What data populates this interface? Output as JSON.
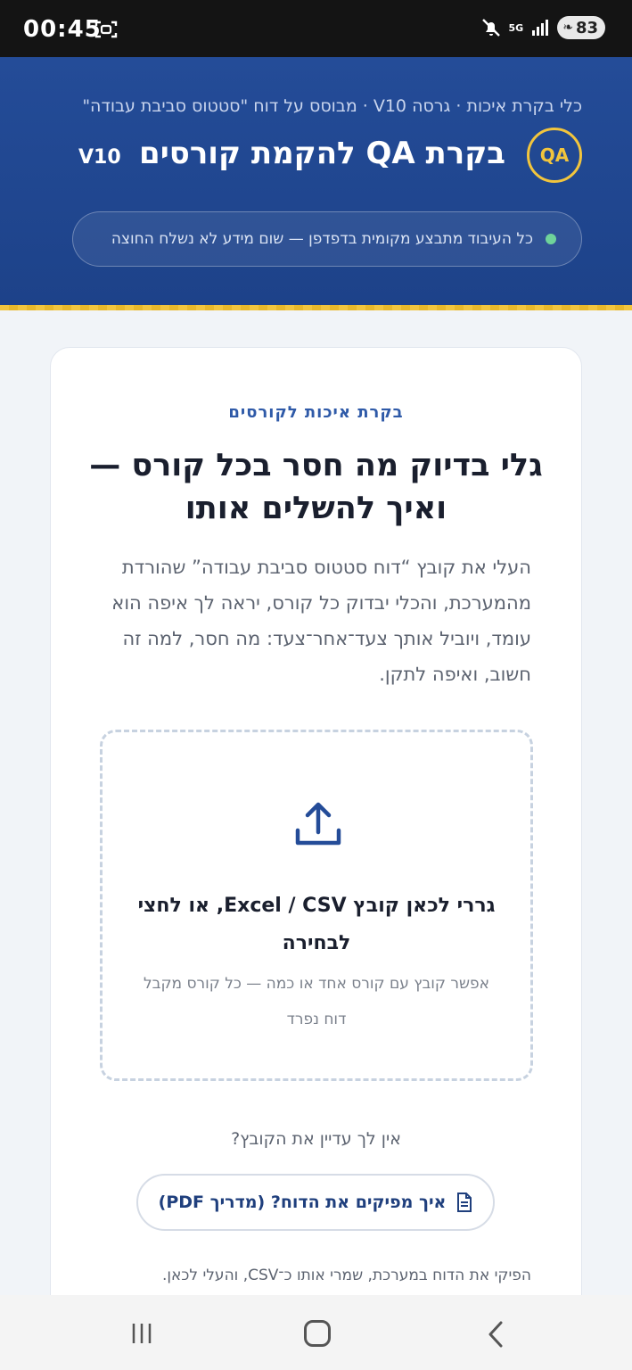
{
  "status_bar": {
    "time": "00:45",
    "network": "5G",
    "battery": "83"
  },
  "header": {
    "subline": "כלי בקרת איכות · גרסה V10 · מבוסס על דוח \"סטטוס סביבת עבודה\"",
    "badge": "QA",
    "title": "בקרת QA להקמת קורסים",
    "version": "V10",
    "privacy_note": "כל העיבוד מתבצע מקומית בדפדפן — שום מידע לא נשלח החוצה"
  },
  "card": {
    "eyebrow": "בקרת איכות לקורסים",
    "headline": "גלי בדיוק מה חסר בכל קורס — ואיך להשלים אותו",
    "description": "העלי את קובץ “דוח סטטוס סביבת עבודה” שהורדת מהמערכת, והכלי יבדוק כל קורס, יראה לך איפה הוא עומד, ויוביל אותך צעד־אחר־צעד: מה חסר, למה זה חשוב, ואיפה לתקן.",
    "dropzone": {
      "icon": "upload-icon",
      "title": "גררי לכאן קובץ Excel / CSV, או לחצי לבחירה",
      "subtitle": "אפשר קובץ עם קורס אחד או כמה — כל קורס מקבל דוח נפרד"
    },
    "no_file_prompt": "אין לך עדיין את הקובץ?",
    "guide_button": "איך מפיקים את הדוח? (מדריך PDF)",
    "footnote": "הפיקי את הדוח במערכת, שמרי אותו כ־CSV, והעלי לכאן."
  },
  "colors": {
    "header": "#244c98",
    "accent": "#f2c53d",
    "text": "#1a1f2e",
    "link": "#2f5aa8"
  }
}
